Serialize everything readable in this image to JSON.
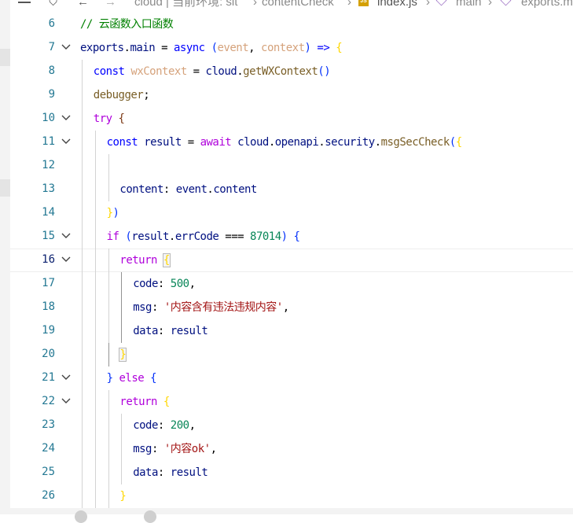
{
  "breadcrumb": {
    "project": "cloud | 当前环境: sit",
    "folder": "contentCheck",
    "file": "index.js",
    "file_badge": "JS",
    "symbol1": "main",
    "symbol2": "exports.m"
  },
  "editor": {
    "lines": [
      {
        "n": "6",
        "tokens": [
          [
            "// 云函数入口函数",
            "c-comment"
          ]
        ]
      },
      {
        "n": "7",
        "tokens": [
          [
            "exports",
            "c-var"
          ],
          [
            ".",
            "c-plain"
          ],
          [
            "main",
            "c-var"
          ],
          [
            " = ",
            "c-plain"
          ],
          [
            "async",
            "c-kw"
          ],
          [
            " ",
            "c-plain"
          ],
          [
            "(",
            "b1"
          ],
          [
            "event",
            "c-param"
          ],
          [
            ", ",
            "c-plain"
          ],
          [
            "context",
            "c-param"
          ],
          [
            ")",
            "b1"
          ],
          [
            " => ",
            "c-kw"
          ],
          [
            "{",
            "by"
          ]
        ]
      },
      {
        "n": "8",
        "tokens": [
          [
            "const",
            "c-kw"
          ],
          [
            " ",
            "c-plain"
          ],
          [
            "wxContext",
            "c-param"
          ],
          [
            " = ",
            "c-plain"
          ],
          [
            "cloud",
            "c-var"
          ],
          [
            ".",
            "c-plain"
          ],
          [
            "getWXContext",
            "c-fn"
          ],
          [
            "()",
            "b1"
          ]
        ]
      },
      {
        "n": "9",
        "tokens": [
          [
            "debugger",
            "c-fn"
          ],
          [
            ";",
            "c-plain"
          ]
        ]
      },
      {
        "n": "10",
        "tokens": [
          [
            "try",
            "c-ctl"
          ],
          [
            " ",
            "c-plain"
          ],
          [
            "{",
            "b3"
          ]
        ]
      },
      {
        "n": "11",
        "tokens": [
          [
            "const",
            "c-kw"
          ],
          [
            " ",
            "c-plain"
          ],
          [
            "result",
            "c-var"
          ],
          [
            " = ",
            "c-plain"
          ],
          [
            "await",
            "c-ctl"
          ],
          [
            " ",
            "c-plain"
          ],
          [
            "cloud",
            "c-var"
          ],
          [
            ".",
            "c-plain"
          ],
          [
            "openapi",
            "c-var"
          ],
          [
            ".",
            "c-plain"
          ],
          [
            "security",
            "c-var"
          ],
          [
            ".",
            "c-plain"
          ],
          [
            "msgSecCheck",
            "c-fn"
          ],
          [
            "(",
            "b1"
          ],
          [
            "{",
            "by"
          ]
        ]
      },
      {
        "n": "12",
        "tokens": []
      },
      {
        "n": "13",
        "tokens": [
          [
            "content",
            "c-var"
          ],
          [
            ": ",
            "c-plain"
          ],
          [
            "event",
            "c-var"
          ],
          [
            ".",
            "c-plain"
          ],
          [
            "content",
            "c-var"
          ]
        ]
      },
      {
        "n": "14",
        "tokens": [
          [
            "}",
            "by"
          ],
          [
            ")",
            "b1"
          ]
        ]
      },
      {
        "n": "15",
        "tokens": [
          [
            "if",
            "c-ctl"
          ],
          [
            " ",
            "c-plain"
          ],
          [
            "(",
            "b1"
          ],
          [
            "result",
            "c-var"
          ],
          [
            ".",
            "c-plain"
          ],
          [
            "errCode",
            "c-var"
          ],
          [
            " === ",
            "c-plain"
          ],
          [
            "87014",
            "c-num"
          ],
          [
            ")",
            "b1"
          ],
          [
            " ",
            "c-plain"
          ],
          [
            "{",
            "b1"
          ]
        ]
      },
      {
        "n": "16",
        "tokens": [
          [
            "return",
            "c-ctl"
          ],
          [
            " ",
            "c-plain"
          ],
          [
            "{",
            "by bracket-hl"
          ]
        ]
      },
      {
        "n": "17",
        "tokens": [
          [
            "code",
            "c-var"
          ],
          [
            ": ",
            "c-plain"
          ],
          [
            "500",
            "c-num"
          ],
          [
            ",",
            "c-plain"
          ]
        ]
      },
      {
        "n": "18",
        "tokens": [
          [
            "msg",
            "c-var"
          ],
          [
            ": ",
            "c-plain"
          ],
          [
            "'内容含有违法违规内容'",
            "c-str"
          ],
          [
            ",",
            "c-plain"
          ]
        ]
      },
      {
        "n": "19",
        "tokens": [
          [
            "data",
            "c-var"
          ],
          [
            ": ",
            "c-plain"
          ],
          [
            "result",
            "c-var"
          ]
        ]
      },
      {
        "n": "20",
        "tokens": [
          [
            "}",
            "by bracket-hl"
          ]
        ]
      },
      {
        "n": "21",
        "tokens": [
          [
            "}",
            "b1"
          ],
          [
            " ",
            "c-plain"
          ],
          [
            "else",
            "c-ctl"
          ],
          [
            " ",
            "c-plain"
          ],
          [
            "{",
            "b1"
          ]
        ]
      },
      {
        "n": "22",
        "tokens": [
          [
            "return",
            "c-ctl"
          ],
          [
            " ",
            "c-plain"
          ],
          [
            "{",
            "by"
          ]
        ]
      },
      {
        "n": "23",
        "tokens": [
          [
            "code",
            "c-var"
          ],
          [
            ": ",
            "c-plain"
          ],
          [
            "200",
            "c-num"
          ],
          [
            ",",
            "c-plain"
          ]
        ]
      },
      {
        "n": "24",
        "tokens": [
          [
            "msg",
            "c-var"
          ],
          [
            ": ",
            "c-plain"
          ],
          [
            "'内容ok'",
            "c-str"
          ],
          [
            ",",
            "c-plain"
          ]
        ]
      },
      {
        "n": "25",
        "tokens": [
          [
            "data",
            "c-var"
          ],
          [
            ": ",
            "c-plain"
          ],
          [
            "result",
            "c-var"
          ]
        ]
      },
      {
        "n": "26",
        "tokens": [
          [
            "}",
            "by"
          ]
        ]
      }
    ]
  }
}
